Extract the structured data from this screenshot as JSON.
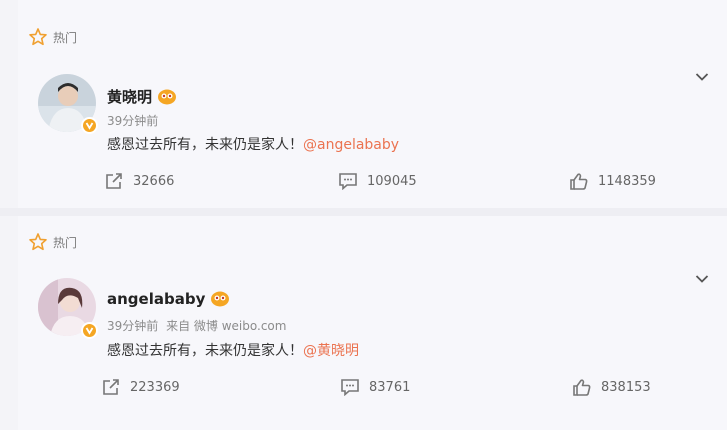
{
  "posts": [
    {
      "hot_label": "热门",
      "username": "黄晓明",
      "time": "39分钟前",
      "source": "",
      "text": "感恩过去所有，未来仍是家人！",
      "mention": "@angelababy",
      "reposts": "32666",
      "comments": "109045",
      "likes": "1148359"
    },
    {
      "hot_label": "热门",
      "username": "angelababy",
      "time": "39分钟前",
      "source": "来自 微博 weibo.com",
      "text": "感恩过去所有，未来仍是家人！",
      "mention": "@黄晓明",
      "reposts": "223369",
      "comments": "83761",
      "likes": "838153"
    }
  ],
  "colors": {
    "mention": "#eb7350",
    "star": "#f0a030",
    "verified_badge": "#f5a623"
  },
  "icons": [
    "star-icon",
    "verified-icon",
    "member-badge-icon",
    "chevron-down-icon",
    "repost-icon",
    "comment-icon",
    "like-icon"
  ]
}
